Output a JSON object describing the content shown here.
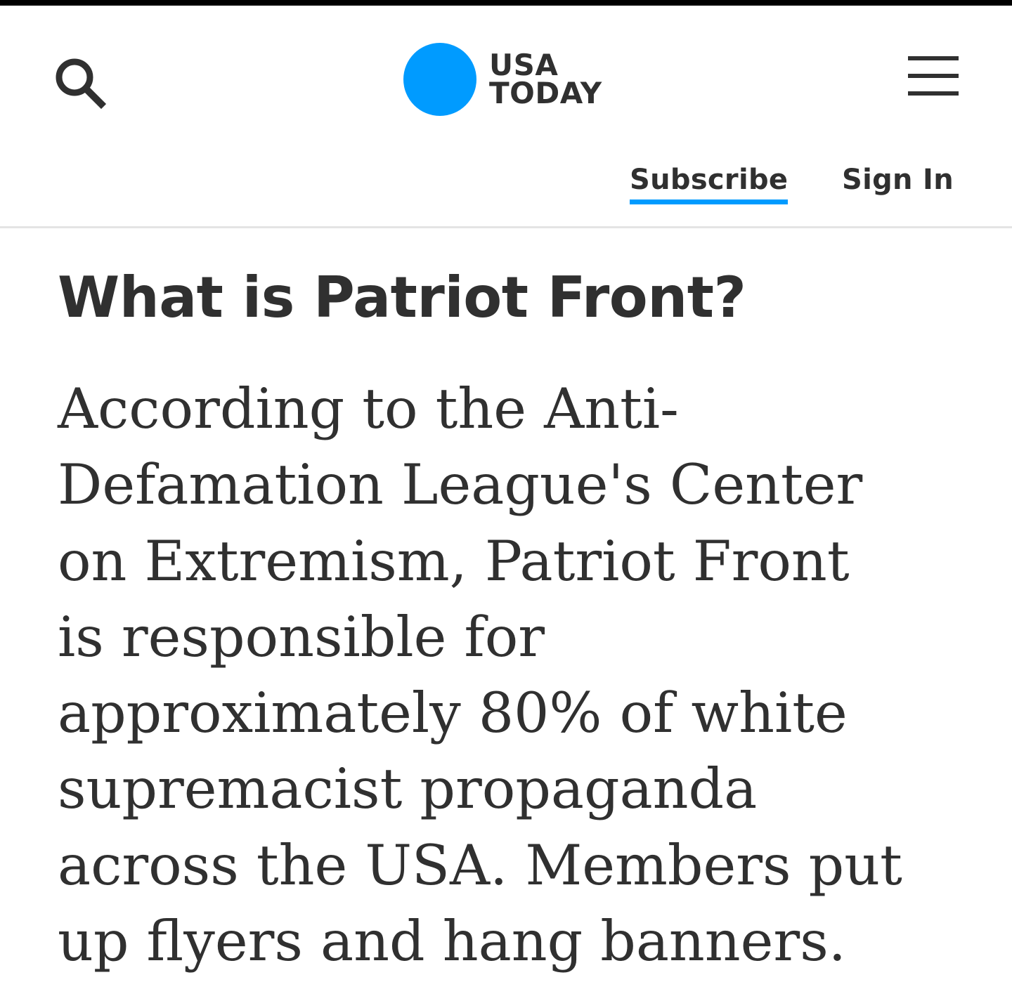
{
  "header": {
    "logo_line1": "USA",
    "logo_line2": "TODAY",
    "subscribe_label": "Subscribe",
    "signin_label": "Sign In",
    "accent_color": "#009bff"
  },
  "icons": {
    "search": "search-icon",
    "menu": "hamburger-menu-icon"
  },
  "article": {
    "headline": "What is Patriot Front?",
    "body_lines": [
      "According to the Anti-",
      "Defamation League's Center",
      "on Extremism, Patriot Front",
      "is responsible for",
      "approximately 80% of white",
      "supremacist propaganda",
      "across the USA. Members put",
      "up flyers and hang banners."
    ]
  }
}
